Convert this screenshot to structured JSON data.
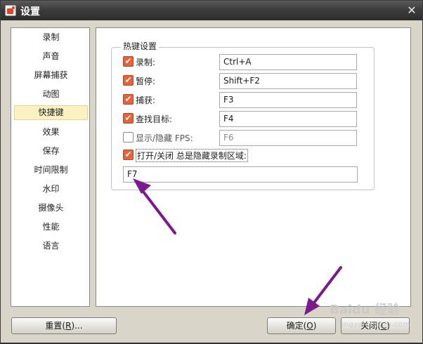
{
  "window": {
    "title": "设置",
    "close_glyph": "✕"
  },
  "sidebar": {
    "items": [
      {
        "label": "录制"
      },
      {
        "label": "声音"
      },
      {
        "label": "屏幕捕获"
      },
      {
        "label": "动图"
      },
      {
        "label": "快捷键",
        "active": true
      },
      {
        "label": "效果"
      },
      {
        "label": "保存"
      },
      {
        "label": "时间限制"
      },
      {
        "label": "水印"
      },
      {
        "label": "摄像头"
      },
      {
        "label": "性能"
      },
      {
        "label": "语言"
      }
    ]
  },
  "hotkeys": {
    "group_title": "热键设置",
    "rows": [
      {
        "label": "录制:",
        "checked": true,
        "value": "Ctrl+A",
        "enabled": true
      },
      {
        "label": "暂停:",
        "checked": true,
        "value": "Shift+F2",
        "enabled": true
      },
      {
        "label": "捕获:",
        "checked": true,
        "value": "F3",
        "enabled": true
      },
      {
        "label": "查找目标:",
        "checked": true,
        "value": "F4",
        "enabled": true
      },
      {
        "label": "显示/隐藏 FPS:",
        "checked": false,
        "value": "F6",
        "enabled": false
      }
    ],
    "toggle_area": {
      "label": "打开/关闭 总是隐藏录制区域:",
      "checked": true,
      "value": "F7"
    }
  },
  "footer": {
    "reset_label": "重置(",
    "reset_key": "R",
    "reset_suffix": ")...",
    "ok_label": "确定(",
    "ok_key": "O",
    "ok_suffix": ")",
    "close_label": "关闭(",
    "close_key": "C",
    "close_suffix": ")"
  },
  "watermark": {
    "main": "Baidu 经验",
    "sub": "jingyan.baidu.com"
  },
  "colors": {
    "checkbox_checked": "#e8623a",
    "sidebar_active": "#fbf2c4",
    "annotation_arrow": "#7a1a8c"
  },
  "icons": {
    "app": "recorder-app-icon",
    "close": "close-icon",
    "check": "checkmark-icon",
    "arrow": "annotation-arrow-icon"
  }
}
